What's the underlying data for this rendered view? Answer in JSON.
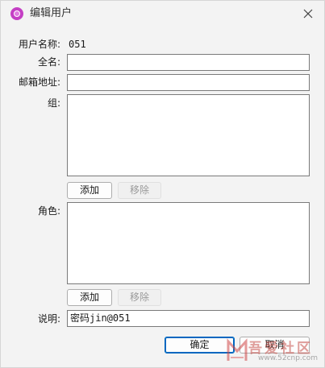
{
  "window": {
    "title": "编辑用户"
  },
  "form": {
    "username_label": "用户名称:",
    "username_value": "051",
    "fullname_label": "全名:",
    "fullname_value": "",
    "email_label": "邮箱地址:",
    "email_value": "",
    "groups_label": "组:",
    "roles_label": "角色:",
    "description_label": "说明:",
    "description_value": "密码jin@051"
  },
  "buttons": {
    "groups_add": "添加",
    "groups_remove": "移除",
    "roles_add": "添加",
    "roles_remove": "移除",
    "ok": "确定",
    "cancel": "取消"
  },
  "watermark": {
    "text": "吾爱社区",
    "url": "www.52cnp.com"
  },
  "colors": {
    "accent": "#0067c0",
    "app_icon": "#c43fc4",
    "background": "#f3f3f3"
  }
}
